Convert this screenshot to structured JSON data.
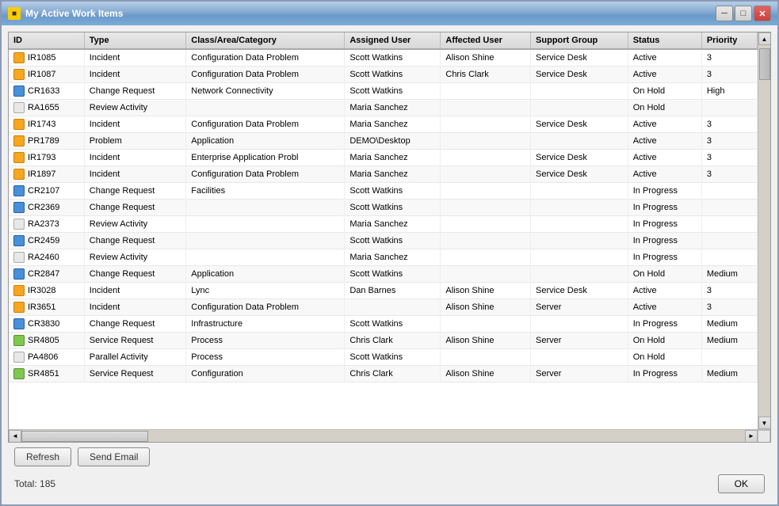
{
  "window": {
    "title": "My Active Work Items",
    "controls": {
      "minimize": "─",
      "maximize": "□",
      "close": "✕"
    }
  },
  "table": {
    "columns": [
      "ID",
      "Type",
      "Class/Area/Category",
      "Assigned User",
      "Affected User",
      "Support Group",
      "Status",
      "Priority"
    ],
    "rows": [
      {
        "id": "IR1085",
        "type": "Incident",
        "class_area": "Configuration Data Problem",
        "assigned": "Scott Watkins",
        "affected": "Alison Shine",
        "support_group": "Service Desk",
        "status": "Active",
        "priority": "3",
        "icon": "incident"
      },
      {
        "id": "IR1087",
        "type": "Incident",
        "class_area": "Configuration Data Problem",
        "assigned": "Scott Watkins",
        "affected": "Chris Clark",
        "support_group": "Service Desk",
        "status": "Active",
        "priority": "3",
        "icon": "incident"
      },
      {
        "id": "CR1633",
        "type": "Change Request",
        "class_area": "Network Connectivity",
        "assigned": "Scott Watkins",
        "affected": "",
        "support_group": "",
        "status": "On Hold",
        "priority": "High",
        "icon": "change"
      },
      {
        "id": "RA1655",
        "type": "Review Activity",
        "class_area": "",
        "assigned": "Maria Sanchez",
        "affected": "",
        "support_group": "",
        "status": "On Hold",
        "priority": "",
        "icon": "review"
      },
      {
        "id": "IR1743",
        "type": "Incident",
        "class_area": "Configuration Data Problem",
        "assigned": "Maria Sanchez",
        "affected": "",
        "support_group": "Service Desk",
        "status": "Active",
        "priority": "3",
        "icon": "incident"
      },
      {
        "id": "PR1789",
        "type": "Problem",
        "class_area": "Application",
        "assigned": "DEMO\\Desktop",
        "affected": "",
        "support_group": "",
        "status": "Active",
        "priority": "3",
        "icon": "problem"
      },
      {
        "id": "IR1793",
        "type": "Incident",
        "class_area": "Enterprise Application Probl",
        "assigned": "Maria Sanchez",
        "affected": "",
        "support_group": "Service Desk",
        "status": "Active",
        "priority": "3",
        "icon": "incident"
      },
      {
        "id": "IR1897",
        "type": "Incident",
        "class_area": "Configuration Data Problem",
        "assigned": "Maria Sanchez",
        "affected": "",
        "support_group": "Service Desk",
        "status": "Active",
        "priority": "3",
        "icon": "incident"
      },
      {
        "id": "CR2107",
        "type": "Change Request",
        "class_area": "Facilities",
        "assigned": "Scott Watkins",
        "affected": "",
        "support_group": "",
        "status": "In Progress",
        "priority": "",
        "icon": "change"
      },
      {
        "id": "CR2369",
        "type": "Change Request",
        "class_area": "",
        "assigned": "Scott Watkins",
        "affected": "",
        "support_group": "",
        "status": "In Progress",
        "priority": "",
        "icon": "change"
      },
      {
        "id": "RA2373",
        "type": "Review Activity",
        "class_area": "",
        "assigned": "Maria Sanchez",
        "affected": "",
        "support_group": "",
        "status": "In Progress",
        "priority": "",
        "icon": "review"
      },
      {
        "id": "CR2459",
        "type": "Change Request",
        "class_area": "",
        "assigned": "Scott Watkins",
        "affected": "",
        "support_group": "",
        "status": "In Progress",
        "priority": "",
        "icon": "change"
      },
      {
        "id": "RA2460",
        "type": "Review Activity",
        "class_area": "",
        "assigned": "Maria Sanchez",
        "affected": "",
        "support_group": "",
        "status": "In Progress",
        "priority": "",
        "icon": "review"
      },
      {
        "id": "CR2847",
        "type": "Change Request",
        "class_area": "Application",
        "assigned": "Scott Watkins",
        "affected": "",
        "support_group": "",
        "status": "On Hold",
        "priority": "Medium",
        "icon": "change"
      },
      {
        "id": "IR3028",
        "type": "Incident",
        "class_area": "Lync",
        "assigned": "Dan Barnes",
        "affected": "Alison Shine",
        "support_group": "Service Desk",
        "status": "Active",
        "priority": "3",
        "icon": "incident"
      },
      {
        "id": "IR3651",
        "type": "Incident",
        "class_area": "Configuration Data Problem",
        "assigned": "",
        "affected": "Alison Shine",
        "support_group": "Server",
        "status": "Active",
        "priority": "3",
        "icon": "incident"
      },
      {
        "id": "CR3830",
        "type": "Change Request",
        "class_area": "Infrastructure",
        "assigned": "Scott Watkins",
        "affected": "",
        "support_group": "",
        "status": "In Progress",
        "priority": "Medium",
        "icon": "change"
      },
      {
        "id": "SR4805",
        "type": "Service Request",
        "class_area": "Process",
        "assigned": "Chris Clark",
        "affected": "Alison Shine",
        "support_group": "Server",
        "status": "On Hold",
        "priority": "Medium",
        "icon": "service"
      },
      {
        "id": "PA4806",
        "type": "Parallel Activity",
        "class_area": "Process",
        "assigned": "Scott Watkins",
        "affected": "",
        "support_group": "",
        "status": "On Hold",
        "priority": "",
        "icon": "parallel"
      },
      {
        "id": "SR4851",
        "type": "Service Request",
        "class_area": "Configuration",
        "assigned": "Chris Clark",
        "affected": "Alison Shine",
        "support_group": "Server",
        "status": "In Progress",
        "priority": "Medium",
        "icon": "service"
      }
    ]
  },
  "footer": {
    "refresh_label": "Refresh",
    "send_email_label": "Send Email",
    "total_label": "Total: 185",
    "ok_label": "OK"
  }
}
